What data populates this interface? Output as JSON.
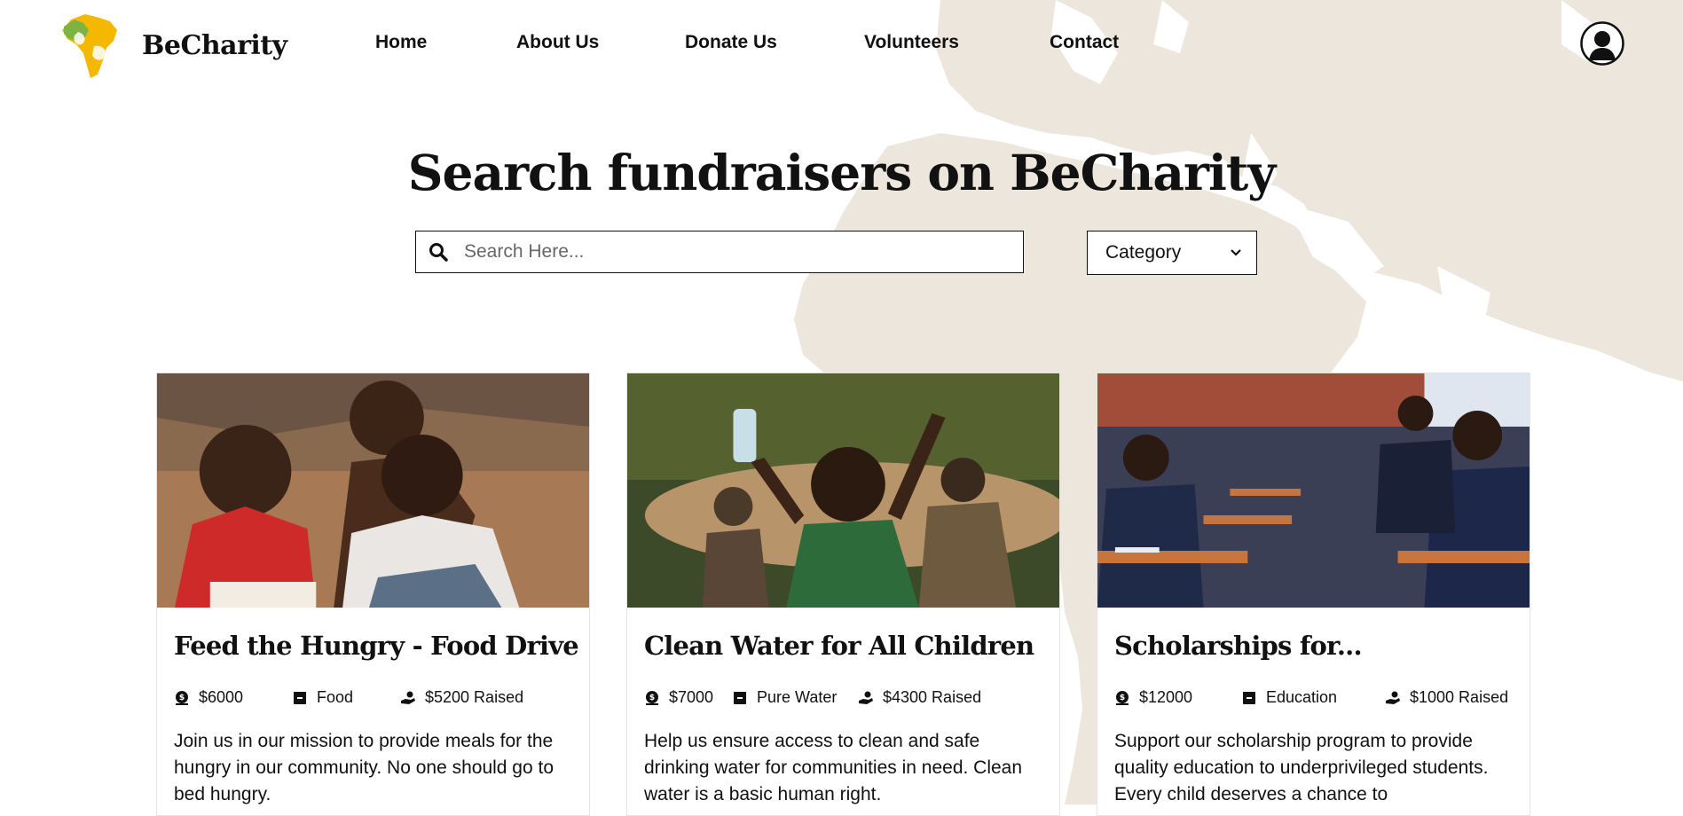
{
  "brand": {
    "name": "BeCharity",
    "logo_icon": "africa-hands-logo"
  },
  "nav": {
    "items": [
      "Home",
      "About Us",
      "Donate Us",
      "Volunteers",
      "Contact"
    ]
  },
  "header": {
    "avatar_icon": "user-avatar-icon"
  },
  "hero": {
    "title": "Search fundraisers on BeCharity"
  },
  "search": {
    "placeholder": "Search Here...",
    "value": "",
    "icon": "search-icon"
  },
  "category": {
    "label": "Category",
    "icon": "chevron-down-icon"
  },
  "colors": {
    "map": "#ece6dc",
    "logo_green": "#7cb342",
    "logo_yellow": "#f5b800"
  },
  "cards": [
    {
      "title": "Feed the Hungry - Food Drive",
      "goal": "$6000",
      "category": "Food",
      "raised": "$5200 Raised",
      "description": "Join us in our mission to provide meals for the hungry in our community. No one should go to bed hungry."
    },
    {
      "title": "Clean Water for All Children",
      "goal": "$7000",
      "category": "Pure Water",
      "raised": "$4300 Raised",
      "description": "Help us ensure access to clean and safe drinking water for communities in need. Clean water is a basic human right."
    },
    {
      "title": "Scholarships for...",
      "goal": "$12000",
      "category": "Education",
      "raised": "$1000 Raised",
      "description": "Support our scholarship program to provide quality education to underprivileged students. Every child deserves a chance to"
    }
  ]
}
